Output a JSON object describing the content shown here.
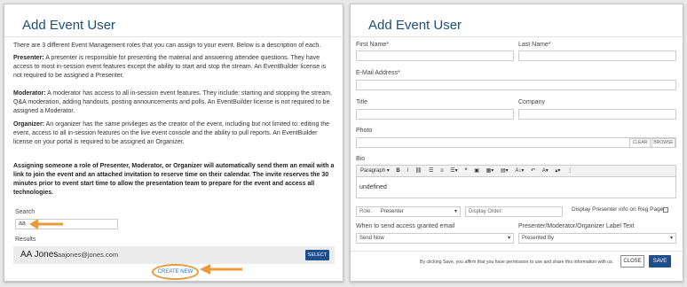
{
  "left": {
    "title": "Add Event User",
    "intro": "There are 3 different Event Management roles that you can assign to your event. Below is a description of each.",
    "roles": [
      {
        "name": "Presenter:",
        "desc": " A presenter is responsible for presenting the material and answering attendee questions. They have access to most in-session event features except the ability to start and stop the stream. An EventBuilder license is not required to be assigned a Presenter."
      },
      {
        "name": "Moderator:",
        "desc": " A moderator has access to all in-session event features. They include: starting and stopping the stream, Q&A moderation, adding handouts, posting announcements and polls. An EventBuilder license is not required to be assigned a Moderator."
      },
      {
        "name": "Organizer:",
        "desc": " An organizer has the same privileges as the creator of the event, including but not limited to: editing the event, access to all in-session features on the live event console and the ability to pull reports. An EventBuilder license on your portal is required to be assigned an Organizer."
      }
    ],
    "notice": "Assigning someone a role of Presenter, Moderator, or Organizer will automatically send them an email with a link to join the event and an attached invitation to reserve time on their calendar. The invite reserves the 30 minutes prior to event start time to allow the presentation team to prepare for the event and access all technologies.",
    "search_label": "Search",
    "search_value": "aa",
    "results_label": "Results",
    "result": {
      "name": "AA Jones",
      "email": "aajones@jones.com",
      "select_label": "SELECT"
    },
    "create_new_label": "CREATE NEW",
    "annotation_color": "#e89a3c"
  },
  "right": {
    "title": "Add Event User",
    "first_name_label": "First Name*",
    "last_name_label": "Last Name*",
    "email_label": "E-Mail Address*",
    "title_label": "Title",
    "company_label": "Company",
    "photo_label": "Photo",
    "clear_label": "CLEAR",
    "browse_label": "BROWSE",
    "bio_label": "Bio",
    "toolbar_paragraph": "Paragraph",
    "bio_value": "undefined",
    "role_label": "Role:",
    "role_value": "Presenter",
    "display_order_label": "Display Order:",
    "display_presenter_label": "Display Presenter info on Reg Page",
    "when_send_label": "When to send access granted email",
    "when_send_value": "Send Now",
    "label_text_label": "Presenter/Moderator/Organizer Label Text",
    "label_text_value": "Presented By",
    "consent_text": "By clicking Save, you affirm that you have permission to use and share this information with us.",
    "close_label": "CLOSE",
    "save_label": "SAVE",
    "accent_color": "#1e4e8c"
  }
}
